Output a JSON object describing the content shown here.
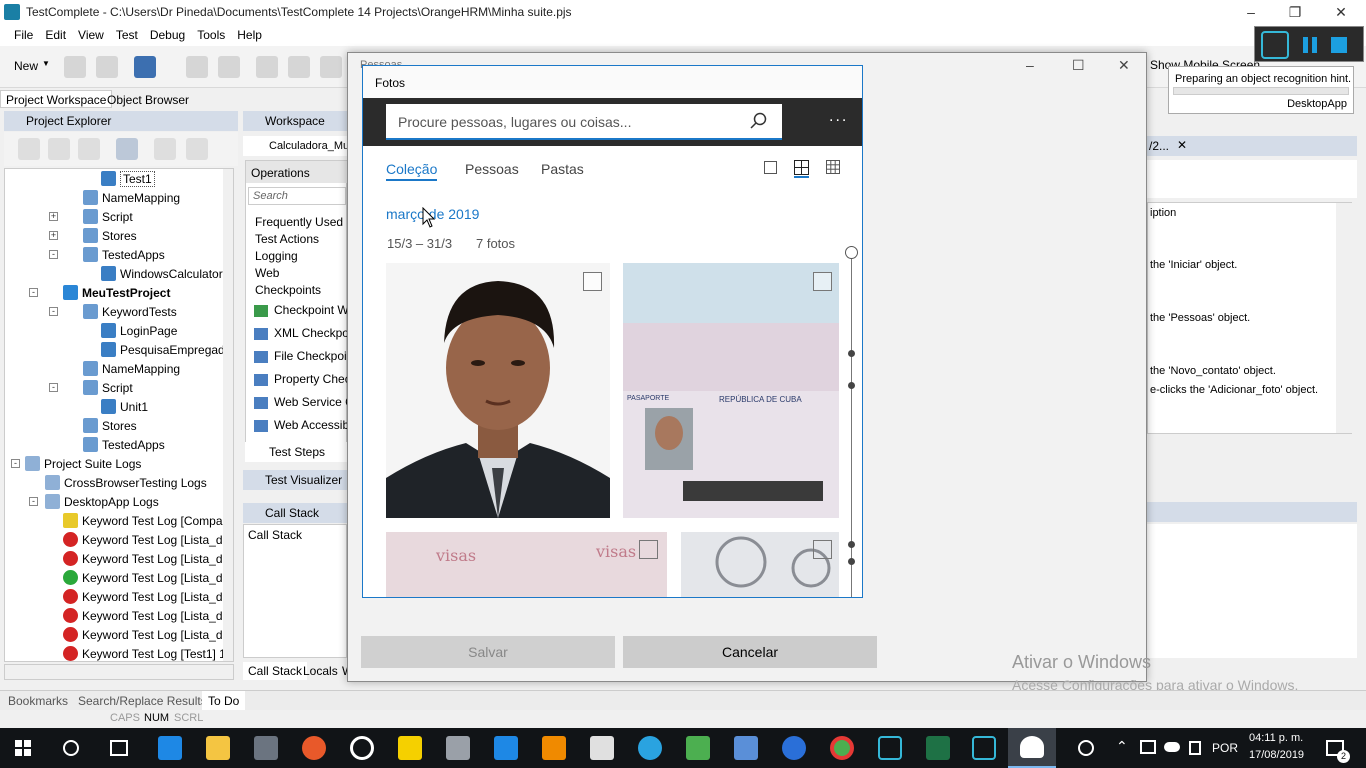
{
  "app": {
    "title": "TestComplete - C:\\Users\\Dr Pineda\\Documents\\TestComplete 14 Projects\\OrangeHRM\\Minha suite.pjs",
    "menu": [
      "File",
      "Edit",
      "View",
      "Test",
      "Debug",
      "Tools",
      "Help"
    ],
    "toolbar_new": "New",
    "show_mobile": "Show Mobile Screen"
  },
  "left_panel": {
    "tabs": [
      "Project Workspace",
      "Object Browser"
    ],
    "explorer_title": "Project Explorer",
    "tree": [
      "Test1",
      "NameMapping",
      "Script",
      "Stores",
      "TestedApps",
      "WindowsCalculator",
      "MeuTestProject",
      "KeywordTests",
      "LoginPage",
      "PesquisaEmpregado",
      "NameMapping",
      "Script",
      "Unit1",
      "Stores",
      "TestedApps",
      "Project Suite Logs",
      "CrossBrowserTesting Logs",
      "DesktopApp Logs",
      "Keyword Test Log [Comparac",
      "Keyword Test Log [Lista_de_",
      "Keyword Test Log [Lista_de_",
      "Keyword Test Log [Lista_de_",
      "Keyword Test Log [Lista_de_",
      "Keyword Test Log [Lista_de_",
      "Keyword Test Log [Lista_de_",
      "Keyword Test Log [Test1] 17"
    ]
  },
  "workspace": {
    "title": "Workspace",
    "doc_tab": "Calculadora_Mul",
    "operations_title": "Operations",
    "search_placeholder": "Search",
    "ops": [
      "Frequently Used",
      "Test Actions",
      "Logging",
      "Web",
      "Checkpoints",
      "Checkpoint Wiz",
      "XML Checkpoin",
      "File Checkpoint",
      "Property Check",
      "Web Service Ch",
      "Web Accessibili"
    ],
    "test_steps": "Test Steps",
    "test_visualizer": "Test Visualizer",
    "call_stack_title": "Call Stack",
    "call_stack_header": "Call Stack",
    "bottom_tabs": [
      "Call Stack",
      "Locals",
      "W"
    ]
  },
  "right_panel": {
    "tab": "/2...",
    "desc_header": "iption",
    "lines": [
      "the 'Iniciar' object.",
      "the 'Pessoas' object.",
      "the 'Novo_contato' object.",
      "e-clicks the 'Adicionar_foto' object."
    ]
  },
  "recorder": {
    "hint": "Preparing an object recognition hint.",
    "app": "DesktopApp"
  },
  "pessoas_dialog": {
    "title": "Pessoas",
    "save": "Salvar",
    "cancel": "Cancelar"
  },
  "fotos": {
    "title": "Fotos",
    "search_placeholder": "Procure pessoas, lugares ou coisas...",
    "more": "...",
    "tabs": [
      "Coleção",
      "Pessoas",
      "Pastas"
    ],
    "month": "março de 2019",
    "range": "15/3 – 31/3",
    "count": "7 fotos",
    "passport_header": "REPÚBLICA DE CUBA",
    "passport_word": "PASAPORTE",
    "visas": "visas"
  },
  "bottom_tabs": [
    "Bookmarks",
    "Search/Replace Results",
    "To Do"
  ],
  "status": [
    "CAPS",
    "NUM",
    "SCRL"
  ],
  "watermark": {
    "line1": "Ativar o Windows",
    "line2": "Acesse Configurações para ativar o Windows."
  },
  "taskbar": {
    "lang": "POR",
    "time": "04:11 p. m.",
    "date": "17/08/2019",
    "notif": "2"
  },
  "colors": {
    "accent": "#1b78c8",
    "taskbar": "#111417",
    "panel_header": "#d4dce8"
  }
}
